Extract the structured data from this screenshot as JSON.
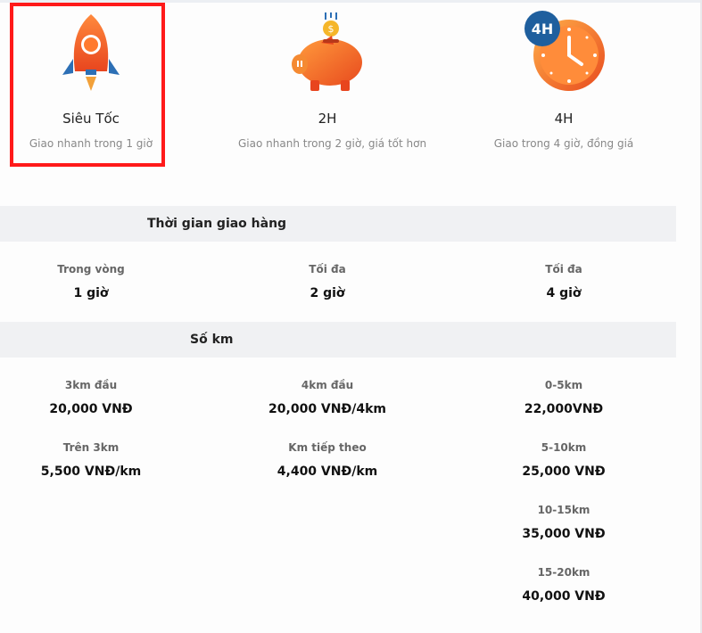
{
  "services": [
    {
      "title": "Siêu Tốc",
      "desc": "Giao nhanh trong 1 giờ",
      "icon": "rocket-icon",
      "selected": true
    },
    {
      "title": "2H",
      "desc": "Giao nhanh trong 2 giờ, giá tốt hơn",
      "icon": "piggy-bank-icon",
      "selected": false
    },
    {
      "title": "4H",
      "desc": "Giao trong 4 giờ, đồng giá",
      "icon": "clock-4h-icon",
      "selected": false,
      "badge": "4H"
    }
  ],
  "delivery_time": {
    "heading": "Thời gian giao hàng",
    "cols": [
      {
        "label": "Trong vòng",
        "value": "1 giờ"
      },
      {
        "label": "Tối đa",
        "value": "2 giờ"
      },
      {
        "label": "Tối đa",
        "value": "4 giờ"
      }
    ]
  },
  "distance": {
    "heading": "Số km",
    "col1": [
      {
        "label": "3km đầu",
        "value": "20,000 VNĐ"
      },
      {
        "label": "Trên 3km",
        "value": "5,500 VNĐ/km"
      }
    ],
    "col2": [
      {
        "label": "4km đầu",
        "value": "20,000 VNĐ/4km"
      },
      {
        "label": "Km tiếp theo",
        "value": "4,400 VNĐ/km"
      }
    ],
    "col3": [
      {
        "label": "0-5km",
        "value": "22,000VNĐ"
      },
      {
        "label": "5-10km",
        "value": "25,000 VNĐ"
      },
      {
        "label": "10-15km",
        "value": "35,000 VNĐ"
      },
      {
        "label": "15-20km",
        "value": "40,000 VNĐ"
      }
    ]
  },
  "colors": {
    "highlight": "#ff1a1a",
    "band": "#f0f1f3",
    "accent_orange": "#f26a21",
    "accent_blue": "#1f5f9e"
  }
}
